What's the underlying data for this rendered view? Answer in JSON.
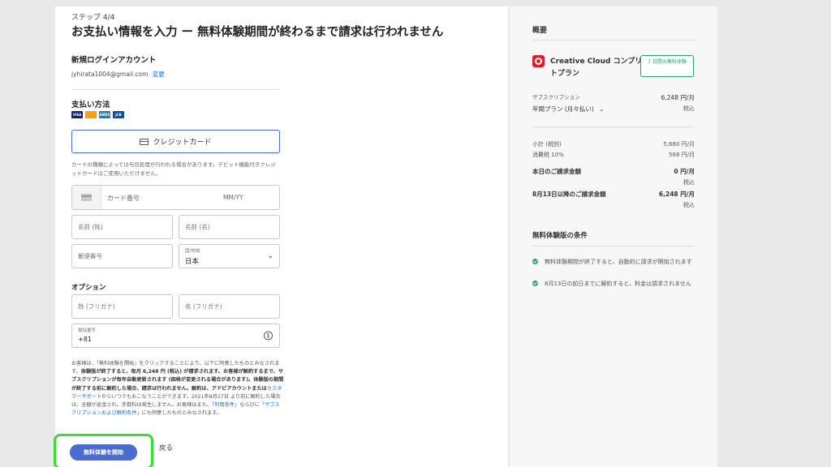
{
  "checkout": {
    "step": "ステップ 4/4",
    "title": "お支払い情報を入力 ー 無料体験期間が終わるまで請求は行われません",
    "account_heading": "新規ログインアカウント",
    "email": "jyhirata1004@gmail.com",
    "change_link": "変更",
    "payment_heading": "支払い方法",
    "card_brands": [
      "VISA",
      "MC",
      "AMEX",
      "JCB"
    ],
    "credit_card_button": "クレジットカード",
    "card_note": "カードの種類によっては与信処理が行われる場合があります。デビット機能付きクレジットカードはご使用いただけません。",
    "card_number_placeholder": "カード番号",
    "expiry_placeholder": "MM/YY",
    "last_name_placeholder": "名前 (姓)",
    "first_name_placeholder": "名前 (名)",
    "postal_placeholder": "郵便番号",
    "country_label": "国/地域",
    "country_value": "日本",
    "options_heading": "オプション",
    "kana_last_placeholder": "姓 (フリガナ)",
    "kana_first_placeholder": "名 (フリガナ)",
    "phone_label": "電話番号",
    "phone_value": "+81",
    "legal": {
      "p1": "お客様は、「無料体験を開始」をクリックすることにより、以下に同意したものとみなされます。",
      "p2": "体験版が終了すると、毎月 6,248 円 (税込) が請求されます。お客様が解約するまで、サブスクリプションが毎年自動更新されます (価格が変更される場合があります)。体験版の期間が終了する前に解約した場合、請求は行われません。",
      "p3": "解約は、アドビアカウントまたは",
      "link1": "カスタマーサポート",
      "p4": "からいつでもおこなうことができます。2021年8月27日 より前に解約した場合は、全額が返金され、手数料は発生しません。お客様はまた、",
      "link2": "「利用条件」",
      "p5": "ならびに",
      "link3": "「サブスクリプションおよび解約条件」",
      "p6": "にも同意したものとみなされます。"
    },
    "start_button": "無料体験を開始",
    "back_link": "戻る"
  },
  "summary": {
    "heading": "概要",
    "product_name": "Creative Cloud コンプリートプラン",
    "trial_badge": "7 日間の無料体験",
    "subscription_label": "サブスクリプション",
    "plan_select": "年間プラン (月々払い)",
    "plan_price": "6,248 円/月",
    "tax_included": "税込",
    "subtotal_label": "小計 (税別)",
    "subtotal_value": "5,680 円/月",
    "tax_label": "消費税 10%",
    "tax_value": "568 円/月",
    "today_label": "本日のご請求金額",
    "today_value": "0 円/月",
    "after_label": "8月13日以降のご請求金額",
    "after_value": "6,248 円/月",
    "conditions_heading": "無料体験版の条件",
    "conditions": [
      "無料体験期間が終了すると、自動的に請求が開始されます",
      "8月13日の前日までに解約すると、料金は請求されません"
    ]
  },
  "colors": {
    "accent": "#4a6bd1",
    "highlight_border": "#33e033",
    "success": "#2d9d78",
    "link": "#1473e6"
  }
}
